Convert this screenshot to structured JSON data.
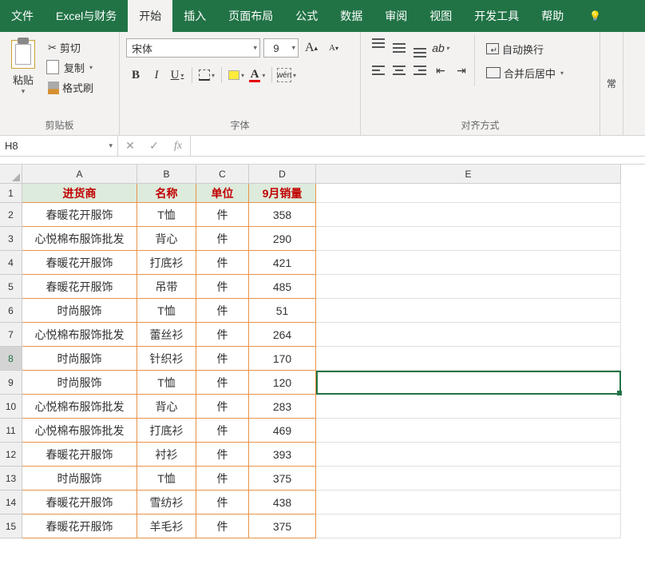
{
  "tabs": [
    "文件",
    "Excel与财务",
    "开始",
    "插入",
    "页面布局",
    "公式",
    "数据",
    "审阅",
    "视图",
    "开发工具",
    "帮助"
  ],
  "active_tab": "开始",
  "clipboard": {
    "paste": "粘贴",
    "cut": "剪切",
    "copy": "复制",
    "painter": "格式刷",
    "group": "剪贴板"
  },
  "font": {
    "name": "宋体",
    "size": "9",
    "group": "字体",
    "wen": "wén"
  },
  "align": {
    "wrap": "自动换行",
    "merge": "合并后居中",
    "group": "对齐方式",
    "general": "常"
  },
  "namebox": "H8",
  "headers": [
    "进货商",
    "名称",
    "单位",
    "9月销量"
  ],
  "rows": [
    {
      "a": "春暖花开服饰",
      "b": "T恤",
      "c": "件",
      "d": "358"
    },
    {
      "a": "心悦棉布服饰批发",
      "b": "背心",
      "c": "件",
      "d": "290"
    },
    {
      "a": "春暖花开服饰",
      "b": "打底衫",
      "c": "件",
      "d": "421"
    },
    {
      "a": "春暖花开服饰",
      "b": "吊带",
      "c": "件",
      "d": "485"
    },
    {
      "a": "时尚服饰",
      "b": "T恤",
      "c": "件",
      "d": "51"
    },
    {
      "a": "心悦棉布服饰批发",
      "b": "蕾丝衫",
      "c": "件",
      "d": "264"
    },
    {
      "a": "时尚服饰",
      "b": "针织衫",
      "c": "件",
      "d": "170"
    },
    {
      "a": "时尚服饰",
      "b": "T恤",
      "c": "件",
      "d": "120"
    },
    {
      "a": "心悦棉布服饰批发",
      "b": "背心",
      "c": "件",
      "d": "283"
    },
    {
      "a": "心悦棉布服饰批发",
      "b": "打底衫",
      "c": "件",
      "d": "469"
    },
    {
      "a": "春暖花开服饰",
      "b": "衬衫",
      "c": "件",
      "d": "393"
    },
    {
      "a": "时尚服饰",
      "b": "T恤",
      "c": "件",
      "d": "375"
    },
    {
      "a": "春暖花开服饰",
      "b": "雪纺衫",
      "c": "件",
      "d": "438"
    },
    {
      "a": "春暖花开服饰",
      "b": "羊毛衫",
      "c": "件",
      "d": "375"
    }
  ],
  "col_letters": [
    "A",
    "B",
    "C",
    "D",
    "E"
  ],
  "selected_row": 8
}
